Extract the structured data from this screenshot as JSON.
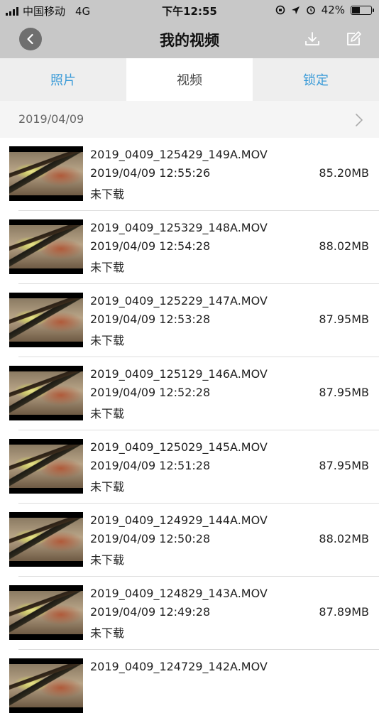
{
  "status_bar": {
    "carrier": "中国移动",
    "network": "4G",
    "time": "下午12:55",
    "battery": "42%"
  },
  "nav": {
    "title": "我的视频",
    "back_icon": "chevron-left-icon",
    "download_icon": "download-icon",
    "edit_icon": "edit-icon"
  },
  "tabs": [
    {
      "label": "照片",
      "active": false
    },
    {
      "label": "视频",
      "active": true
    },
    {
      "label": "锁定",
      "active": false
    }
  ],
  "group": {
    "date": "2019/04/09"
  },
  "videos": [
    {
      "name": "2019_0409_125429_149A.MOV",
      "datetime": "2019/04/09 12:55:26",
      "status": "未下载",
      "size": "85.20MB"
    },
    {
      "name": "2019_0409_125329_148A.MOV",
      "datetime": "2019/04/09 12:54:28",
      "status": "未下载",
      "size": "88.02MB"
    },
    {
      "name": "2019_0409_125229_147A.MOV",
      "datetime": "2019/04/09 12:53:28",
      "status": "未下载",
      "size": "87.95MB"
    },
    {
      "name": "2019_0409_125129_146A.MOV",
      "datetime": "2019/04/09 12:52:28",
      "status": "未下载",
      "size": "87.95MB"
    },
    {
      "name": "2019_0409_125029_145A.MOV",
      "datetime": "2019/04/09 12:51:28",
      "status": "未下载",
      "size": "87.95MB"
    },
    {
      "name": "2019_0409_124929_144A.MOV",
      "datetime": "2019/04/09 12:50:28",
      "status": "未下载",
      "size": "88.02MB"
    },
    {
      "name": "2019_0409_124829_143A.MOV",
      "datetime": "2019/04/09 12:49:28",
      "status": "未下载",
      "size": "87.89MB"
    },
    {
      "name": "2019_0409_124729_142A.MOV",
      "datetime": "",
      "status": "",
      "size": ""
    }
  ],
  "colors": {
    "bar_bg": "#c8c8c8",
    "tab_inactive": "#3a9bd8",
    "tab_active_text": "#444444"
  }
}
